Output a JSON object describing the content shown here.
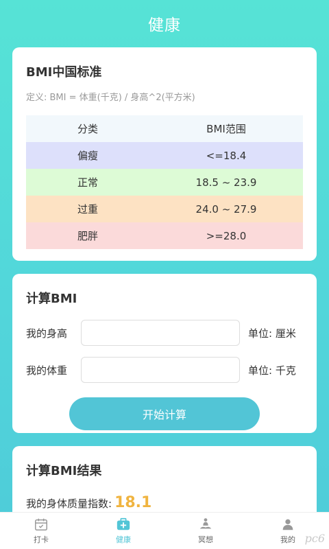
{
  "header": {
    "title": "健康"
  },
  "standard_card": {
    "title": "BMI中国标准",
    "definition": "定义: BMI = 体重(千克) / 身高^2(平方米)",
    "table": {
      "headers": [
        "分类",
        "BMI范围"
      ],
      "rows": [
        {
          "category": "偏瘦",
          "range": "<=18.4",
          "color": "#dde0fb"
        },
        {
          "category": "正常",
          "range": "18.5 ~ 23.9",
          "color": "#ddfbd6"
        },
        {
          "category": "过重",
          "range": "24.0 ~ 27.9",
          "color": "#fde2c3"
        },
        {
          "category": "肥胖",
          "range": ">=28.0",
          "color": "#fbdada"
        }
      ]
    }
  },
  "calc_card": {
    "title": "计算BMI",
    "height_label": "我的身高",
    "height_value": "",
    "height_unit": "单位: 厘米",
    "weight_label": "我的体重",
    "weight_value": "",
    "weight_unit": "单位: 千克",
    "button_label": "开始计算"
  },
  "result_card": {
    "title": "计算BMI结果",
    "label": "我的身体质量指数:",
    "value": "18.1"
  },
  "tabbar": {
    "items": [
      {
        "label": "打卡",
        "icon": "calendar-icon",
        "active": false
      },
      {
        "label": "健康",
        "icon": "medical-kit-icon",
        "active": true
      },
      {
        "label": "冥想",
        "icon": "meditation-icon",
        "active": false
      },
      {
        "label": "我的",
        "icon": "user-icon",
        "active": false
      }
    ]
  },
  "watermark": "pc6",
  "colors": {
    "accent": "#52c5d6",
    "result": "#f0b440"
  }
}
